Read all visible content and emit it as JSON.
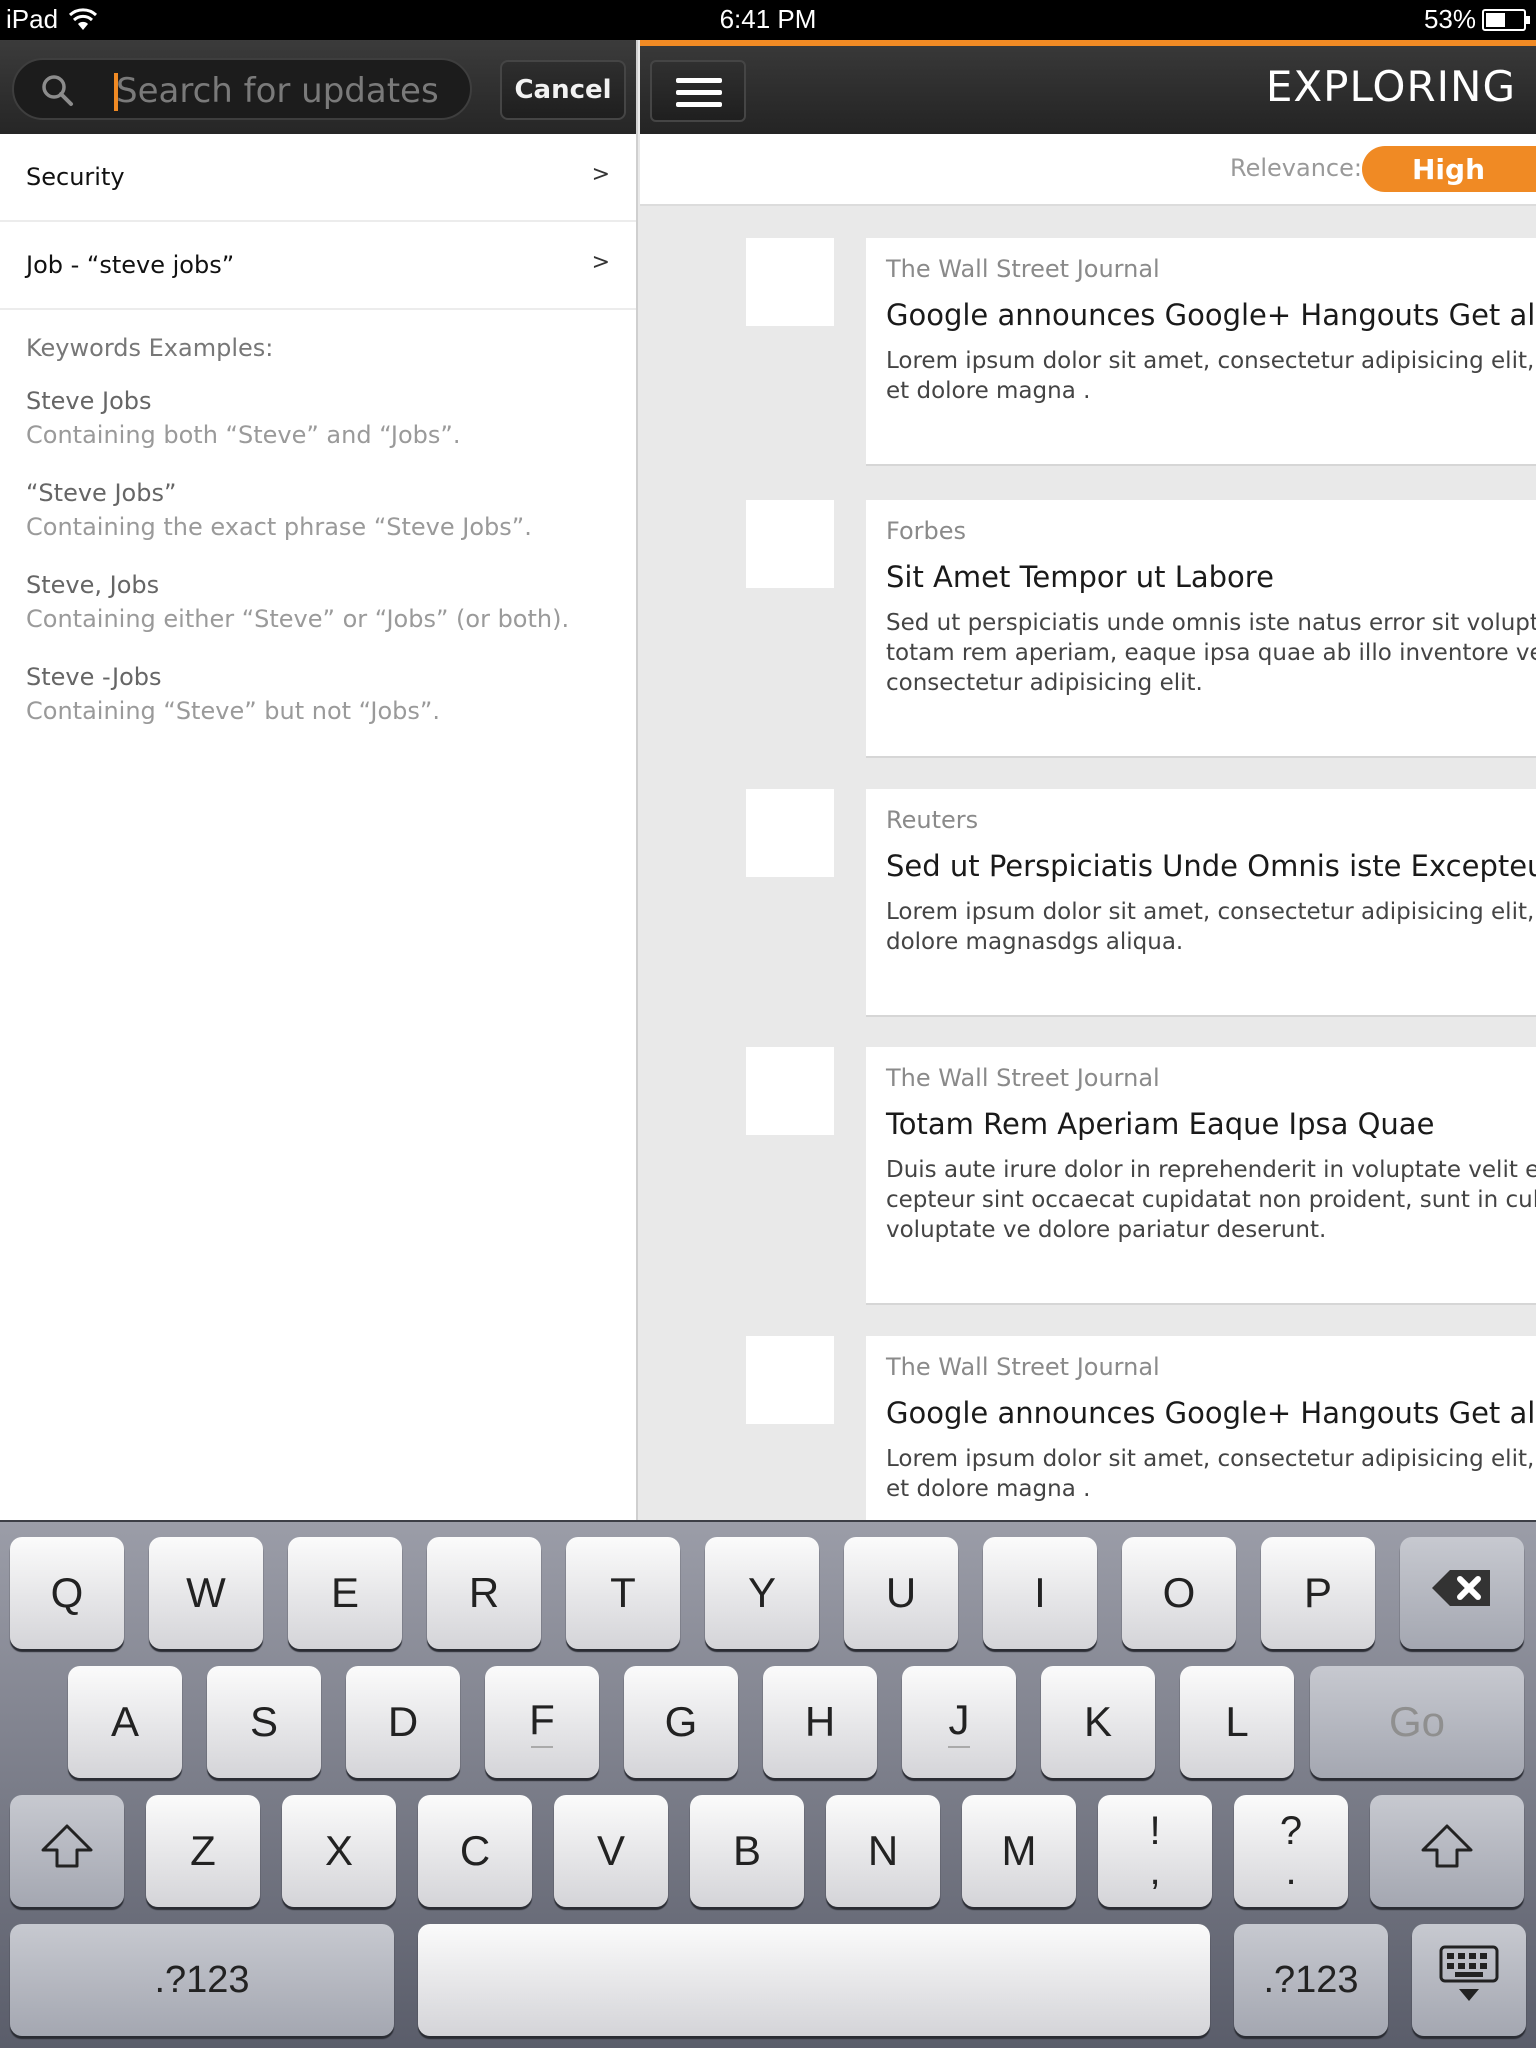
{
  "status_bar": {
    "device": "iPad",
    "time": "6:41 PM",
    "battery": "53%",
    "battery_level": 0.53
  },
  "search": {
    "placeholder": "Search for updates",
    "cancel_label": "Cancel"
  },
  "saved_searches": [
    {
      "label": "Security",
      "chevron": ">"
    },
    {
      "label": "Job - “steve jobs”",
      "chevron": ">"
    }
  ],
  "keywords": {
    "title": "Keywords Examples:",
    "examples": [
      {
        "term": "Steve Jobs",
        "description": "Containing both “Steve” and “Jobs”."
      },
      {
        "term": "“Steve Jobs”",
        "description": "Containing the exact phrase “Steve Jobs”."
      },
      {
        "term": "Steve, Jobs",
        "description": "Containing either “Steve” or “Jobs” (or both)."
      },
      {
        "term": "Steve -Jobs",
        "description": "Containing “Steve” but not “Jobs”."
      }
    ]
  },
  "header": {
    "title": "EXPLORING",
    "relevance_label": "Relevance:",
    "relevance_value": "High"
  },
  "news": [
    {
      "source": "The Wall Street Journal",
      "headline": "Google announces Google+ Hangouts Get all ne",
      "summary": "Lorem ipsum dolor sit amet, consectetur adipisicing elit, se\net dolore magna ."
    },
    {
      "source": "Forbes",
      "headline": "Sit Amet Tempor ut Labore",
      "summary": "Sed ut perspiciatis unde omnis iste natus error sit voluptat\ntotam rem aperiam, eaque ipsa quae ab illo inventore veri\nconsectetur adipisicing elit."
    },
    {
      "source": "Reuters",
      "headline": "Sed ut Perspiciatis Unde Omnis iste Excepteur Si",
      "summary": "Lorem ipsum dolor sit amet, consectetur adipisicing elit, se\ndolore magnasdgs aliqua."
    },
    {
      "source": "The Wall Street Journal",
      "headline": "Totam Rem Aperiam Eaque Ipsa Quae",
      "summary": "Duis aute irure dolor in reprehenderit in voluptate velit ess\ncepteur sint occaecat cupidatat non proident, sunt in culpa\nvoluptate ve dolore pariatur deserunt."
    },
    {
      "source": "The Wall Street Journal",
      "headline": "Google announces Google+ Hangouts Get all ne",
      "summary": "Lorem ipsum dolor sit amet, consectetur adipisicing elit, se\net dolore magna ."
    }
  ],
  "keyboard": {
    "row1": [
      "Q",
      "W",
      "E",
      "R",
      "T",
      "Y",
      "U",
      "I",
      "O",
      "P"
    ],
    "row2": [
      "A",
      "S",
      "D",
      "F",
      "G",
      "H",
      "J",
      "K",
      "L"
    ],
    "go_label": "Go",
    "row3": [
      "Z",
      "X",
      "C",
      "V",
      "B",
      "N",
      "M"
    ],
    "punct1": {
      "top": "!",
      "bottom": ","
    },
    "punct2": {
      "top": "?",
      "bottom": "."
    },
    "numbers_label": ".?123"
  },
  "colors": {
    "accent": "#f08a24",
    "header_bg": "#2c2c2c"
  },
  "icons": {
    "search": "search-icon",
    "menu": "menu-icon",
    "backspace": "backspace-icon",
    "shift": "shift-icon",
    "hide_keyboard": "keyboard-hide-icon",
    "wifi": "wifi-icon",
    "battery": "battery-icon"
  }
}
